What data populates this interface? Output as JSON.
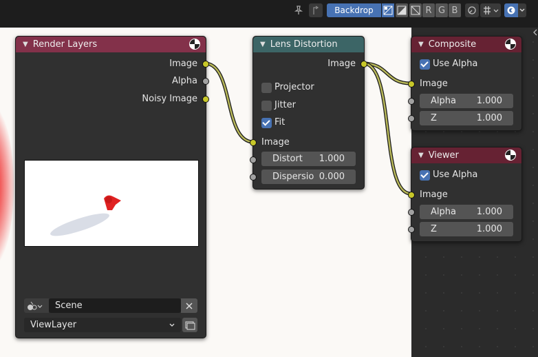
{
  "header": {
    "backdrop_label": "Backdrop",
    "channels": [
      "R",
      "G",
      "B"
    ],
    "icons": [
      "pin-icon",
      "parent-node-icon",
      "rgb-alpha-icon",
      "alpha-icon",
      "rgb-icon",
      "gizmo-icon",
      "snap-grid-icon",
      "overlay-icon"
    ]
  },
  "nodes": {
    "render_layers": {
      "title": "Render Layers",
      "outputs": [
        "Image",
        "Alpha",
        "Noisy Image"
      ],
      "scene_value": "Scene",
      "view_layer_value": "ViewLayer",
      "header_color": "#83314a"
    },
    "lens_distortion": {
      "title": "Lens Distortion",
      "output": "Image",
      "checkboxes": [
        {
          "label": "Projector",
          "checked": false
        },
        {
          "label": "Jitter",
          "checked": false
        },
        {
          "label": "Fit",
          "checked": true
        }
      ],
      "input": "Image",
      "fields": [
        {
          "label": "Distort",
          "value": "1.000"
        },
        {
          "label": "Dispersio",
          "value": "0.000"
        }
      ],
      "header_color": "#3c6566"
    },
    "composite": {
      "title": "Composite",
      "use_alpha_label": "Use Alpha",
      "use_alpha_checked": true,
      "input": "Image",
      "fields": [
        {
          "label": "Alpha",
          "value": "1.000"
        },
        {
          "label": "Z",
          "value": "1.000"
        }
      ],
      "header_color": "#662233"
    },
    "viewer": {
      "title": "Viewer",
      "use_alpha_label": "Use Alpha",
      "use_alpha_checked": true,
      "input": "Image",
      "fields": [
        {
          "label": "Alpha",
          "value": "1.000"
        },
        {
          "label": "Z",
          "value": "1.000"
        }
      ],
      "header_color": "#662233"
    }
  },
  "colors": {
    "socket_image": "#c7c729",
    "socket_value": "#a1a1a1",
    "accent": "#4772b3"
  }
}
